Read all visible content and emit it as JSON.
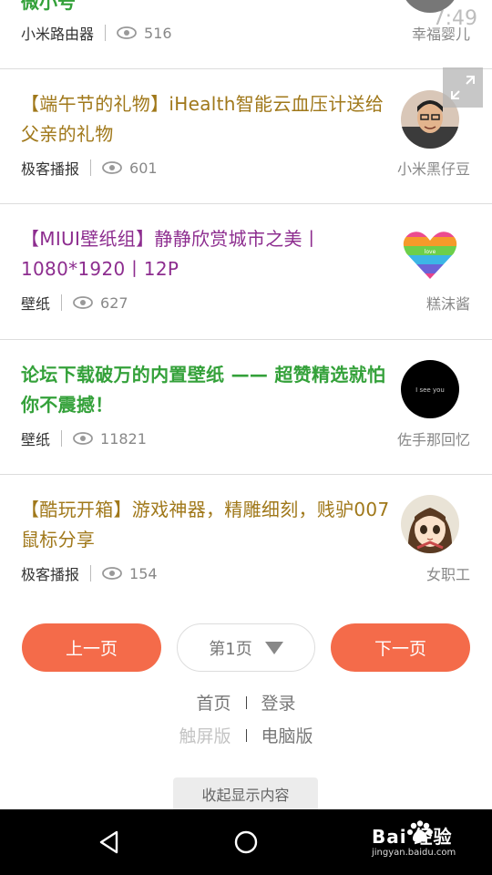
{
  "status": {
    "time": "7:49"
  },
  "posts": [
    {
      "title": "微小号",
      "category": "小米路由器",
      "views": "516",
      "author": "幸福婴儿"
    },
    {
      "title": "【端午节的礼物】iHealth智能云血压计送给父亲的礼物",
      "category": "极客播报",
      "views": "601",
      "author": "小米黑仔豆"
    },
    {
      "title": "【MIUI壁纸组】静静欣赏城市之美丨1080*1920丨12P",
      "category": "壁纸",
      "views": "627",
      "author": "糕沫酱",
      "avatar_text": "love"
    },
    {
      "title": "论坛下载破万的内置壁纸 —— 超赞精选就怕你不震撼！",
      "category": "壁纸",
      "views": "11821",
      "author": "佐手那回忆",
      "avatar_text": "I see you"
    },
    {
      "title": "【酷玩开箱】游戏神器，精雕细刻，贱驴007鼠标分享",
      "category": "极客播报",
      "views": "154",
      "author": "女职工"
    }
  ],
  "pagination": {
    "prev": "上一页",
    "current": "第1页",
    "next": "下一页"
  },
  "footer": {
    "home": "首页",
    "login": "登录",
    "touch_version": "触屏版",
    "pc_version": "电脑版",
    "collapse": "收起显示内容"
  },
  "watermark": {
    "logo": "Bai 经验",
    "url": "jingyan.baidu.com"
  },
  "colors": {
    "accent": "#f46b4a",
    "title_gold": "#a0781a",
    "title_purple": "#8d2d8f",
    "title_green": "#34a13a"
  },
  "icons": [
    "eye-icon",
    "expand-icon",
    "back-nav-icon",
    "home-nav-icon",
    "paw-icon"
  ]
}
